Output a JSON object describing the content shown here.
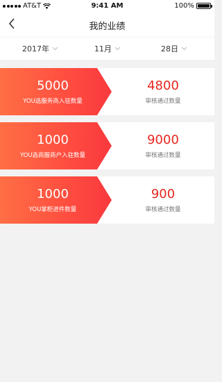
{
  "status_bar": {
    "carrier": "AT&T",
    "time": "9:41 AM",
    "battery": "100%"
  },
  "nav": {
    "title": "我的业绩"
  },
  "filters": [
    {
      "label": "2017年"
    },
    {
      "label": "11月"
    },
    {
      "label": "28日"
    }
  ],
  "cards": [
    {
      "value": "5000",
      "label": "YOU选服务商入驻数量",
      "approved_value": "4800",
      "approved_label": "审核通过数量"
    },
    {
      "value": "1000",
      "label": "YOU选商服商户入驻数量",
      "approved_value": "9000",
      "approved_label": "审核通过数量"
    },
    {
      "value": "1000",
      "label": "YOU掌柜进件数量",
      "approved_value": "900",
      "approved_label": "审核通过数量"
    }
  ],
  "colors": {
    "accent": "#e8261f",
    "gradient_start": "#ff6f45",
    "gradient_end": "#f9393e"
  }
}
